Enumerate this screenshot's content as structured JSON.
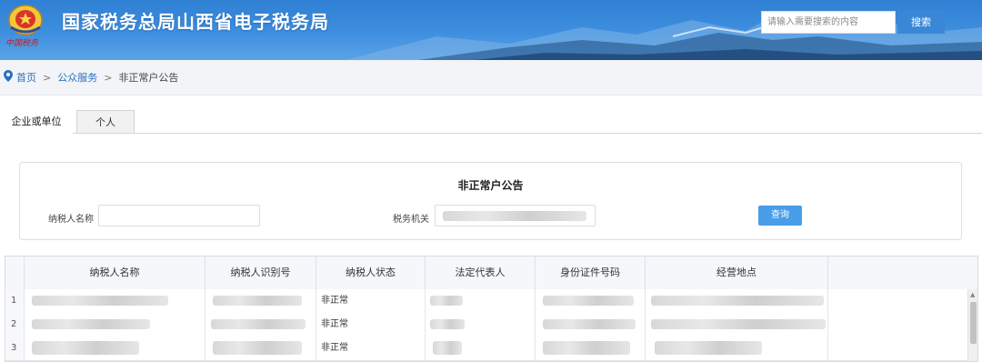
{
  "header": {
    "site_title": "国家税务总局山西省电子税务局",
    "emblem_caption": "中国税务",
    "search_placeholder": "请输入需要搜索的内容",
    "search_button": "搜索"
  },
  "breadcrumb": {
    "home": "首页",
    "separator": ">",
    "public_service": "公众服务",
    "current": "非正常户公告"
  },
  "tabs": [
    {
      "label": "企业或单位",
      "active": true
    },
    {
      "label": "个人",
      "active": false
    }
  ],
  "query_panel": {
    "title": "非正常户公告",
    "taxpayer_name_label": "纳税人名称",
    "taxpayer_name_value": "",
    "tax_authority_label": "税务机关",
    "query_button": "查询"
  },
  "table": {
    "columns": [
      "纳税人名称",
      "纳税人识别号",
      "纳税人状态",
      "法定代表人",
      "身份证件号码",
      "经营地点"
    ],
    "rows": [
      {
        "index": "1",
        "status": "非正常"
      },
      {
        "index": "2",
        "status": "非正常"
      },
      {
        "index": "3",
        "status": "非正常"
      }
    ]
  },
  "colors": {
    "banner": "#3f8fe0",
    "link": "#2a6fc1",
    "button": "#4a9de8"
  }
}
